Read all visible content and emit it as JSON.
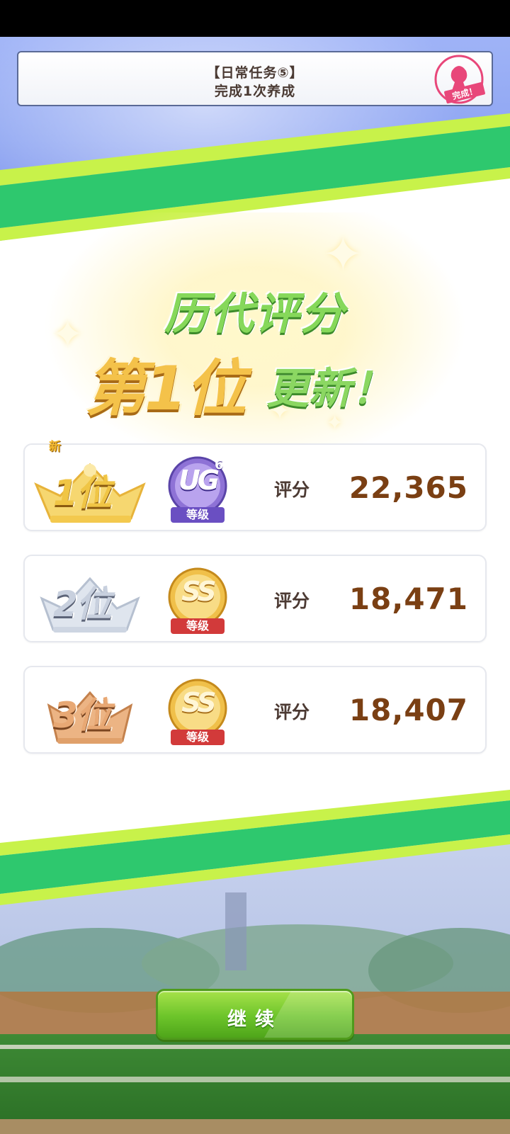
{
  "mission": {
    "title": "【日常任务⑤】",
    "description": "完成1次养成",
    "stamp_text": "完成！"
  },
  "headline": {
    "line1": "历代评分",
    "rank_text": "第1位",
    "updated_text": "更新！"
  },
  "rankings": [
    {
      "rank_label": "1位",
      "is_new": true,
      "new_label": "新",
      "grade": "UG",
      "grade_level": "6",
      "grade_caption": "等级",
      "score_label": "评分",
      "score": "22,365"
    },
    {
      "rank_label": "2位",
      "is_new": false,
      "grade": "SS",
      "grade_caption": "等级",
      "score_label": "评分",
      "score": "18,471"
    },
    {
      "rank_label": "3位",
      "is_new": false,
      "grade": "SS",
      "grade_caption": "等级",
      "score_label": "评分",
      "score": "18,407"
    }
  ],
  "continue_button": {
    "label": "继续"
  },
  "colors": {
    "accent_green": "#6cc42a",
    "score_brown": "#7a3f13",
    "gold": "#f4c24a",
    "silver": "#c7cfdc",
    "bronze": "#e2a06a",
    "ug_purple": "#7a5cc8"
  },
  "icons": {
    "stamp": "complete-stamp-icon",
    "crowns": [
      "gold-crown-icon",
      "silver-crown-icon",
      "bronze-crown-icon"
    ],
    "grades": [
      "ug-grade-badge-icon",
      "ss-grade-badge-icon",
      "ss-grade-badge-icon"
    ]
  }
}
